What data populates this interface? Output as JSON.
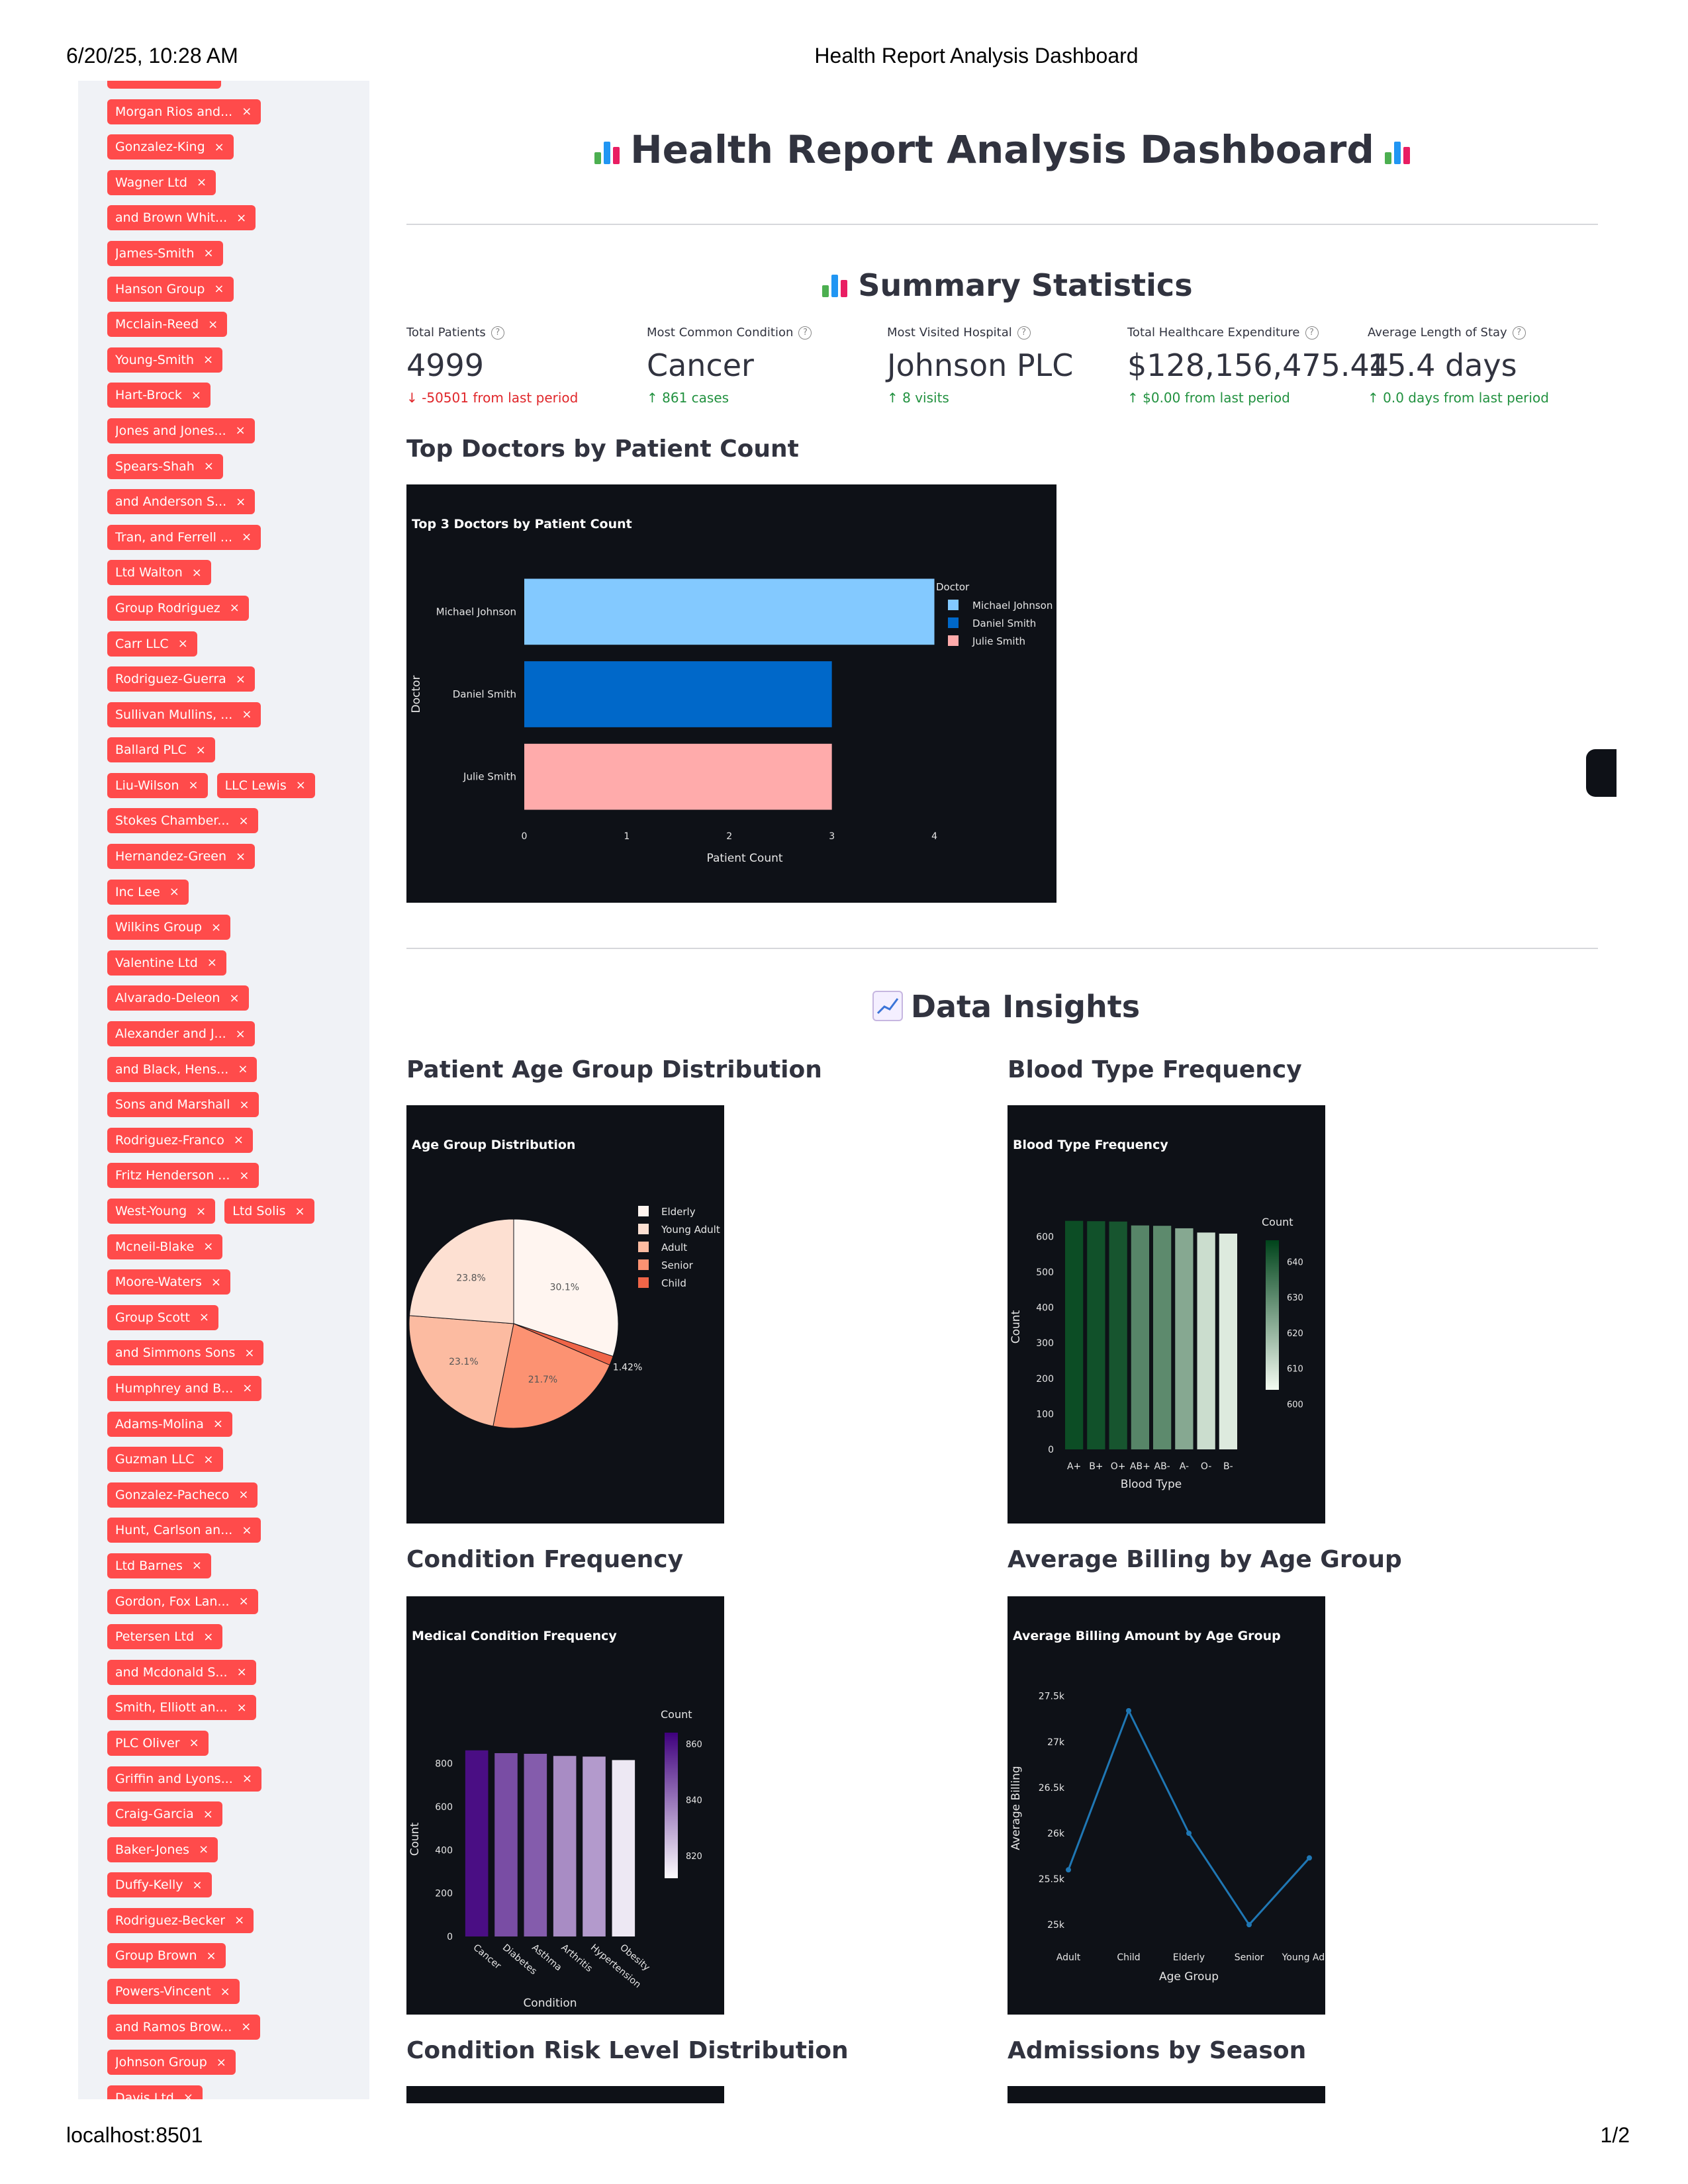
{
  "print": {
    "date": "6/20/25, 10:28 AM",
    "title": "Health Report Analysis Dashboard",
    "url": "localhost:8501",
    "page": "1/2"
  },
  "sidebar": {
    "tag_rows": [
      [
        "Brown-Yoder"
      ],
      [
        "Morgan Rios and..."
      ],
      [
        "Gonzalez-King"
      ],
      [
        "Wagner Ltd"
      ],
      [
        "and Brown Whit..."
      ],
      [
        "James-Smith"
      ],
      [
        "Hanson Group"
      ],
      [
        "Mcclain-Reed"
      ],
      [
        "Young-Smith"
      ],
      [
        "Hart-Brock"
      ],
      [
        "Jones and Jones..."
      ],
      [
        "Spears-Shah"
      ],
      [
        "and Anderson S..."
      ],
      [
        "Tran, and Ferrell ..."
      ],
      [
        "Ltd Walton"
      ],
      [
        "Group Rodriguez"
      ],
      [
        "Carr LLC"
      ],
      [
        "Rodriguez-Guerra"
      ],
      [
        "Sullivan Mullins, ..."
      ],
      [
        "Ballard PLC"
      ],
      [
        "Liu-Wilson",
        "LLC Lewis"
      ],
      [
        "Stokes Chamber..."
      ],
      [
        "Hernandez-Green"
      ],
      [
        "Inc Lee"
      ],
      [
        "Wilkins Group"
      ],
      [
        "Valentine Ltd"
      ],
      [
        "Alvarado-Deleon"
      ],
      [
        "Alexander and J..."
      ],
      [
        "and Black, Hens..."
      ],
      [
        "Sons and Marshall"
      ],
      [
        "Rodriguez-Franco"
      ],
      [
        "Fritz Henderson ..."
      ],
      [
        "West-Young",
        "Ltd Solis"
      ],
      [
        "Mcneil-Blake"
      ],
      [
        "Moore-Waters"
      ],
      [
        "Group Scott"
      ],
      [
        "and Simmons Sons"
      ],
      [
        "Humphrey and B..."
      ],
      [
        "Adams-Molina"
      ],
      [
        "Guzman LLC"
      ],
      [
        "Gonzalez-Pacheco"
      ],
      [
        "Hunt, Carlson an..."
      ],
      [
        "Ltd Barnes"
      ],
      [
        "Gordon, Fox Lan..."
      ],
      [
        "Petersen Ltd"
      ],
      [
        "and Mcdonald S..."
      ],
      [
        "Smith, Elliott an..."
      ],
      [
        "PLC Oliver"
      ],
      [
        "Griffin and Lyons..."
      ],
      [
        "Craig-Garcia"
      ],
      [
        "Baker-Jones"
      ],
      [
        "Duffy-Kelly"
      ],
      [
        "Rodriguez-Becker"
      ],
      [
        "Group Brown"
      ],
      [
        "Powers-Vincent"
      ],
      [
        "and Ramos Brow..."
      ],
      [
        "Johnson Group"
      ],
      [
        "Davis Ltd"
      ]
    ],
    "remove_symbol": "×"
  },
  "main": {
    "title": "Health Report Analysis Dashboard",
    "summary_heading": "Summary Statistics",
    "metrics": [
      {
        "label": "Total Patients",
        "value": "4999",
        "delta": "-50501 from last period",
        "direction": "down"
      },
      {
        "label": "Most Common Condition",
        "value": "Cancer",
        "delta": "861 cases",
        "direction": "up"
      },
      {
        "label": "Most Visited Hospital",
        "value": "Johnson PLC",
        "delta": "8 visits",
        "direction": "up"
      },
      {
        "label": "Total Healthcare Expenditure",
        "value": "$128,156,475.44",
        "delta": "$0.00 from last period",
        "direction": "up"
      },
      {
        "label": "Average Length of Stay",
        "value": "15.4 days",
        "delta": "0.0 days from last period",
        "direction": "up"
      }
    ],
    "top_doctors_heading": "Top Doctors by Patient Count",
    "insights_heading": "Data Insights",
    "age_heading": "Patient Age Group Distribution",
    "blood_heading": "Blood Type Frequency",
    "condition_heading": "Condition Frequency",
    "billing_heading": "Average Billing by Age Group",
    "risk_heading": "Condition Risk Level Distribution",
    "season_heading": "Admissions by Season"
  },
  "colors": {
    "accent": "#ff4b4b",
    "chart_bg": "#0e1117",
    "up": "#21913f",
    "down": "#e0262a"
  },
  "chart_data": [
    {
      "type": "bar",
      "orientation": "horizontal",
      "title": "Top 3 Doctors by Patient Count",
      "xlabel": "Patient Count",
      "ylabel": "Doctor",
      "legend_title": "Doctor",
      "legend_position": "right",
      "categories": [
        "Michael Johnson",
        "Daniel Smith",
        "Julie Smith"
      ],
      "values": [
        4,
        3,
        3
      ],
      "colors": [
        "#83c9ff",
        "#0068c9",
        "#ffabab"
      ],
      "xlim": [
        0,
        4.3
      ],
      "xticks": [
        "0",
        "1",
        "2",
        "3",
        "4"
      ]
    },
    {
      "type": "pie",
      "title": "Age Group Distribution",
      "legend_position": "right",
      "labels": [
        "Elderly",
        "Young Adult",
        "Adult",
        "Senior",
        "Child"
      ],
      "values": [
        30.1,
        23.8,
        23.1,
        21.7,
        1.42
      ],
      "value_labels": [
        "30.1%",
        "23.8%",
        "23.1%",
        "21.7%",
        "1.42%"
      ],
      "colors": [
        "#fff5f0",
        "#fde0d2",
        "#fcbba1",
        "#fc9272",
        "#ef6548"
      ]
    },
    {
      "type": "bar",
      "title": "Blood Type Frequency",
      "xlabel": "Blood Type",
      "ylabel": "Count",
      "colorbar_title": "Count",
      "categories": [
        "A+",
        "B+",
        "O+",
        "AB+",
        "AB-",
        "A-",
        "O-",
        "B-"
      ],
      "values": [
        644,
        643,
        642,
        631,
        630,
        623,
        611,
        608
      ],
      "ylim": [
        0,
        690
      ],
      "yticks": [
        0,
        100,
        200,
        300,
        400,
        500,
        600
      ],
      "colorbar_ticks": [
        600,
        610,
        620,
        630,
        640
      ],
      "color_range": [
        604,
        646
      ]
    },
    {
      "type": "bar",
      "title": "Medical Condition Frequency",
      "xlabel": "Condition",
      "ylabel": "Count",
      "colorbar_title": "Count",
      "categories": [
        "Cancer",
        "Diabetes",
        "Asthma",
        "Arthritis",
        "Hypertension",
        "Obesity"
      ],
      "values": [
        861,
        848,
        845,
        835,
        832,
        816
      ],
      "ylim": [
        0,
        900
      ],
      "yticks": [
        0,
        200,
        400,
        600,
        800
      ],
      "colorbar_ticks": [
        820,
        840,
        860
      ],
      "color_range": [
        812,
        864
      ]
    },
    {
      "type": "line",
      "title": "Average Billing Amount by Age Group",
      "xlabel": "Age Group",
      "ylabel": "Average Billing",
      "categories": [
        "Adult",
        "Child",
        "Elderly",
        "Senior",
        "Young Adult"
      ],
      "values": [
        25600,
        27340,
        26000,
        25000,
        25730
      ],
      "ylim": [
        24900,
        27650
      ],
      "yticks": [
        25000,
        25500,
        26000,
        26500,
        27000,
        27500
      ],
      "ytick_labels": [
        "25k",
        "25.5k",
        "26k",
        "26.5k",
        "27k",
        "27.5k"
      ],
      "line_color": "#1f77b4"
    }
  ]
}
